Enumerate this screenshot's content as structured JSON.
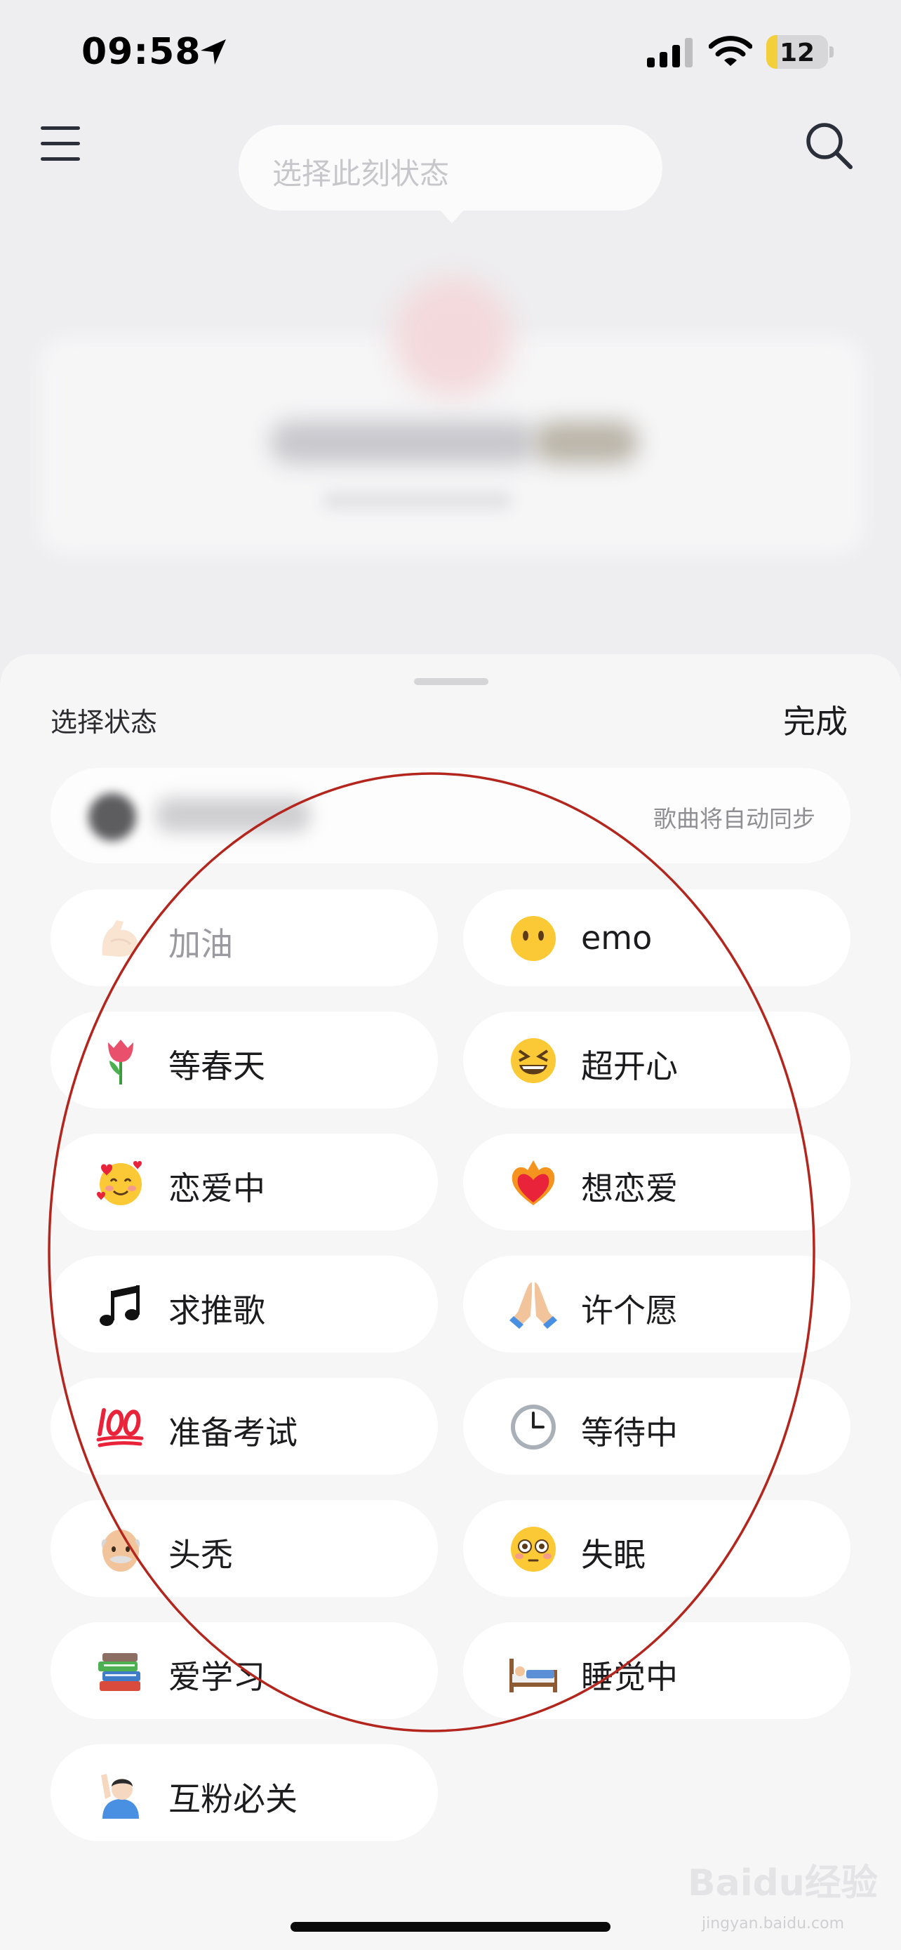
{
  "status_bar": {
    "time": "09:58",
    "battery_level": "12"
  },
  "header": {
    "status_placeholder": "选择此刻状态"
  },
  "sheet": {
    "title": "选择状态",
    "done_label": "完成",
    "music_row": {
      "sync_note": "歌曲将自动同步"
    },
    "statuses": [
      {
        "label": "加油",
        "icon": "flexed-biceps-icon"
      },
      {
        "label": "emo",
        "icon": "neutral-face-icon"
      },
      {
        "label": "等春天",
        "icon": "tulip-icon"
      },
      {
        "label": "超开心",
        "icon": "squinting-laugh-icon"
      },
      {
        "label": "恋爱中",
        "icon": "smiling-hearts-icon"
      },
      {
        "label": "想恋爱",
        "icon": "heart-on-fire-icon"
      },
      {
        "label": "求推歌",
        "icon": "music-notes-icon"
      },
      {
        "label": "许个愿",
        "icon": "folded-hands-icon"
      },
      {
        "label": "准备考试",
        "icon": "hundred-points-icon"
      },
      {
        "label": "等待中",
        "icon": "clock-icon"
      },
      {
        "label": "头秃",
        "icon": "old-man-icon"
      },
      {
        "label": "失眠",
        "icon": "flushed-face-icon"
      },
      {
        "label": "爱学习",
        "icon": "books-icon"
      },
      {
        "label": "睡觉中",
        "icon": "bed-icon"
      },
      {
        "label": "互粉必关",
        "icon": "raising-hand-icon"
      }
    ]
  },
  "watermark": {
    "text": "Baidu经验",
    "subtext": "jingyan.baidu.com"
  },
  "colors": {
    "annotation": "#b3261e",
    "background": "#eeeef0",
    "chip": "#ffffff"
  }
}
